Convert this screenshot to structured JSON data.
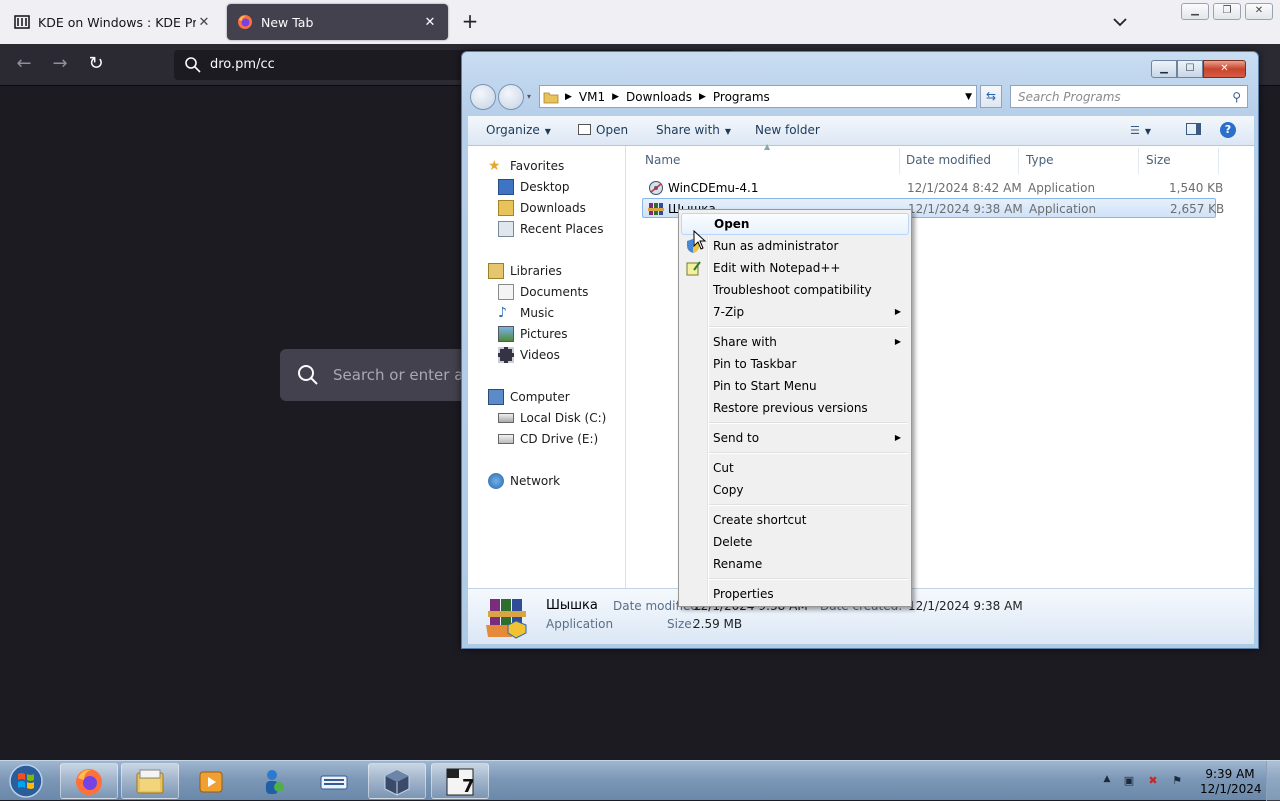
{
  "browser": {
    "tabs": [
      {
        "title": "KDE on Windows : KDE Project",
        "active": false
      },
      {
        "title": "New Tab",
        "active": true
      }
    ],
    "url": "dro.pm/cc",
    "newtab_search_placeholder": "Search or enter add"
  },
  "explorer": {
    "breadcrumb": [
      "VM1",
      "Downloads",
      "Programs"
    ],
    "search_placeholder": "Search Programs",
    "commands": {
      "organize": "Organize",
      "open": "Open",
      "share_with": "Share with",
      "new_folder": "New folder"
    },
    "nav": {
      "favorites": "Favorites",
      "desktop": "Desktop",
      "downloads": "Downloads",
      "recent_places": "Recent Places",
      "libraries": "Libraries",
      "documents": "Documents",
      "music": "Music",
      "pictures": "Pictures",
      "videos": "Videos",
      "computer": "Computer",
      "local_disk": "Local Disk (C:)",
      "cd_drive": "CD Drive (E:)",
      "network": "Network"
    },
    "columns": {
      "name": "Name",
      "date": "Date modified",
      "type": "Type",
      "size": "Size"
    },
    "files": [
      {
        "name": "WinCDEmu-4.1",
        "date": "12/1/2024 8:42 AM",
        "type": "Application",
        "size": "1,540 KB"
      },
      {
        "name": "Шышка",
        "date": "12/1/2024 9:38 AM",
        "type": "Application",
        "size": "2,657 KB"
      }
    ],
    "details": {
      "name": "Шышка",
      "type": "Application",
      "date_modified_label": "Date modified:",
      "date_modified": "12/1/2024 9:38 AM",
      "date_created_label": "Date created:",
      "date_created": "12/1/2024 9:38 AM",
      "size_label": "Size:",
      "size": "2.59 MB"
    }
  },
  "context_menu": {
    "open": "Open",
    "run_as_admin": "Run as administrator",
    "edit_notepad": "Edit with Notepad++",
    "troubleshoot": "Troubleshoot compatibility",
    "seven_zip": "7-Zip",
    "share_with": "Share with",
    "pin_taskbar": "Pin to Taskbar",
    "pin_start": "Pin to Start Menu",
    "restore": "Restore previous versions",
    "send_to": "Send to",
    "cut": "Cut",
    "copy": "Copy",
    "create_shortcut": "Create shortcut",
    "delete": "Delete",
    "rename": "Rename",
    "properties": "Properties"
  },
  "taskbar": {
    "clock_time": "9:39 AM",
    "clock_date": "12/1/2024",
    "apps": [
      "firefox-icon",
      "explorer-icon",
      "media-player-icon",
      "network-user-icon",
      "keyboard-icon",
      "virtualbox-icon",
      "7zip-icon"
    ]
  }
}
